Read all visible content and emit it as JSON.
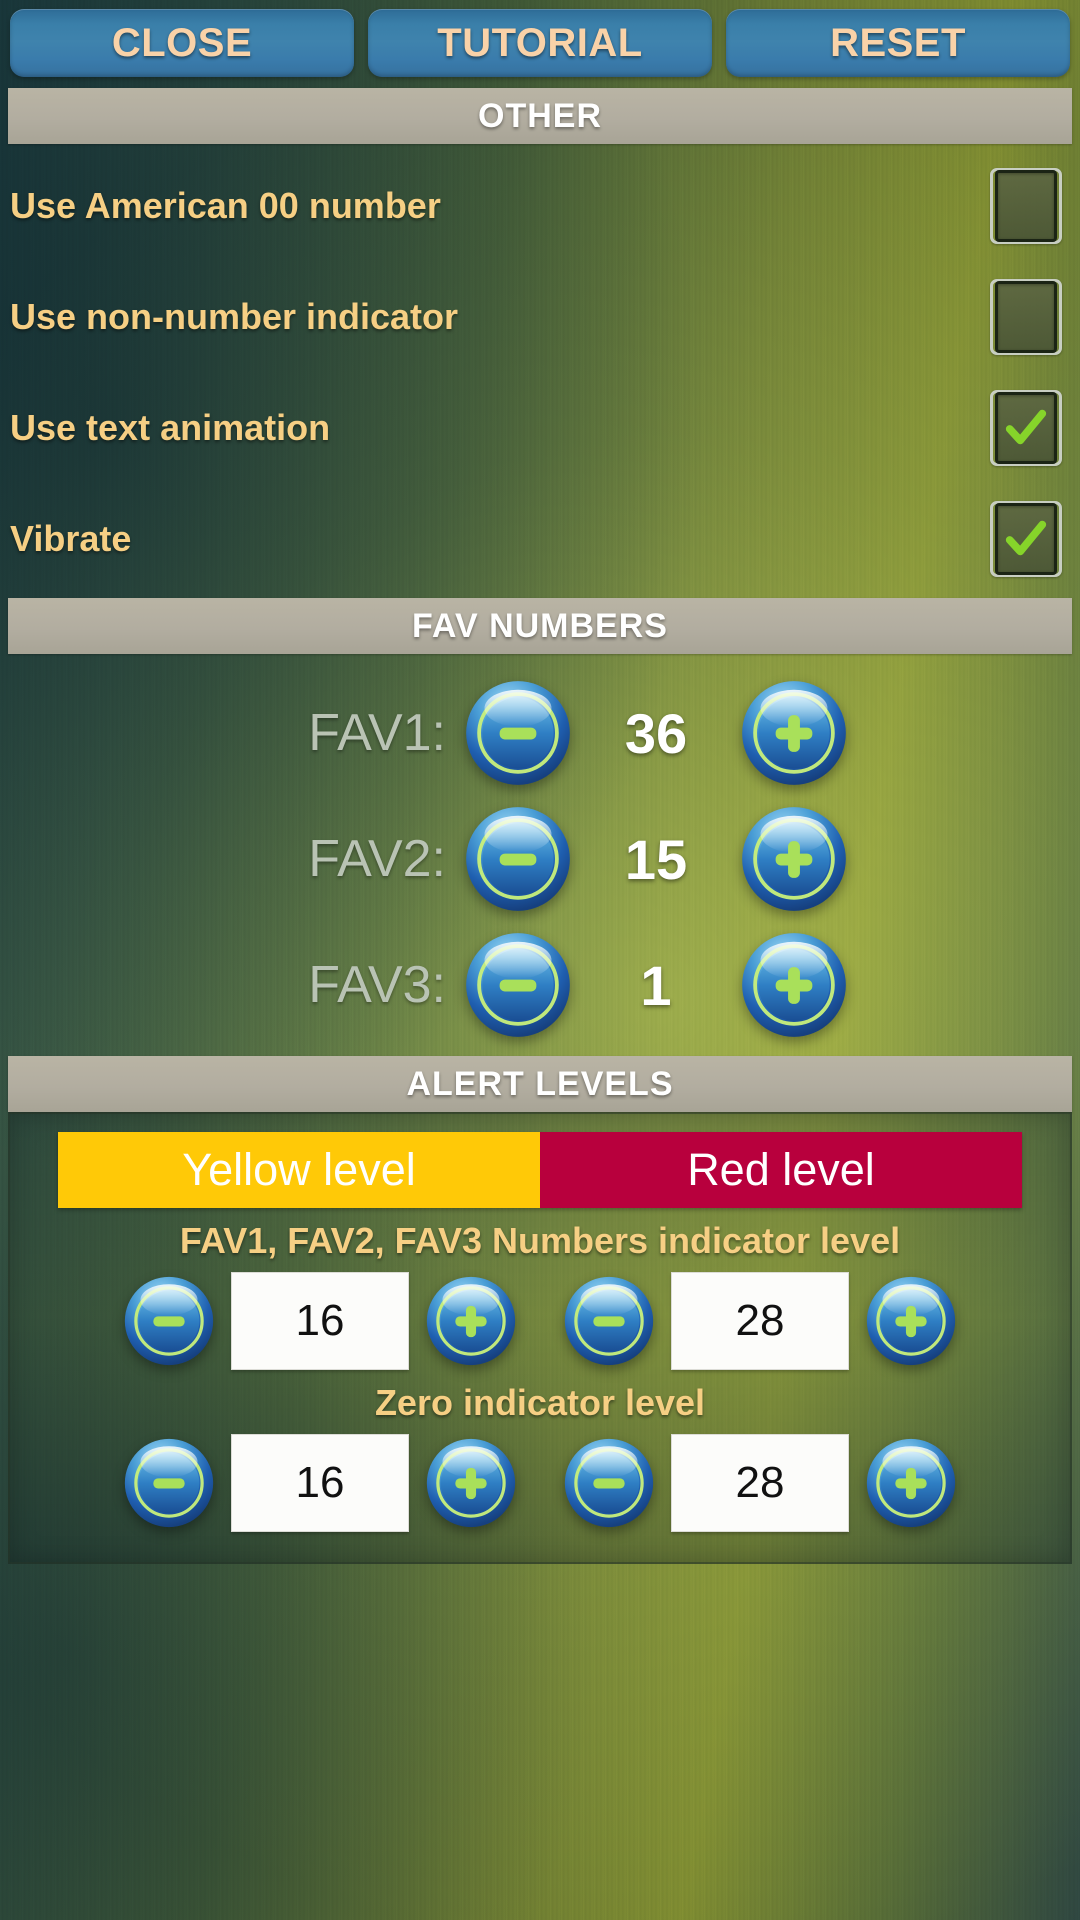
{
  "topbar": {
    "buttons": [
      {
        "label": "CLOSE",
        "name": "close-button"
      },
      {
        "label": "TUTORIAL",
        "name": "tutorial-button"
      },
      {
        "label": "RESET",
        "name": "reset-button"
      }
    ]
  },
  "sections": {
    "other": "OTHER",
    "fav_numbers": "FAV NUMBERS",
    "alert_levels": "ALERT LEVELS"
  },
  "other": {
    "options": [
      {
        "label": "Use American 00 number",
        "checked": false
      },
      {
        "label": "Use non-number indicator",
        "checked": false
      },
      {
        "label": "Use text animation",
        "checked": true
      },
      {
        "label": "Vibrate",
        "checked": true
      }
    ]
  },
  "fav_numbers": {
    "rows": [
      {
        "label": "FAV1:",
        "value": "36"
      },
      {
        "label": "FAV2:",
        "value": "15"
      },
      {
        "label": "FAV3:",
        "value": "1"
      }
    ],
    "decrement_icon": "minus-icon",
    "increment_icon": "plus-icon"
  },
  "alert_levels": {
    "tabs": [
      {
        "label": "Yellow level",
        "color": "#ffc907"
      },
      {
        "label": "Red level",
        "color": "#b8003d"
      }
    ],
    "groups": [
      {
        "title": "FAV1, FAV2, FAV3 Numbers indicator level",
        "yellow_value": "16",
        "red_value": "28"
      },
      {
        "title": "Zero indicator level",
        "yellow_value": "16",
        "red_value": "28"
      }
    ]
  },
  "colors": {
    "accent_text": "#f6cf84",
    "button_text": "#f9d2a8",
    "button_fill": "#3a7fa9",
    "header_bar": "#b2ada0",
    "checkmark": "#86d42a",
    "yellow": "#ffc907",
    "red": "#b8003d"
  }
}
